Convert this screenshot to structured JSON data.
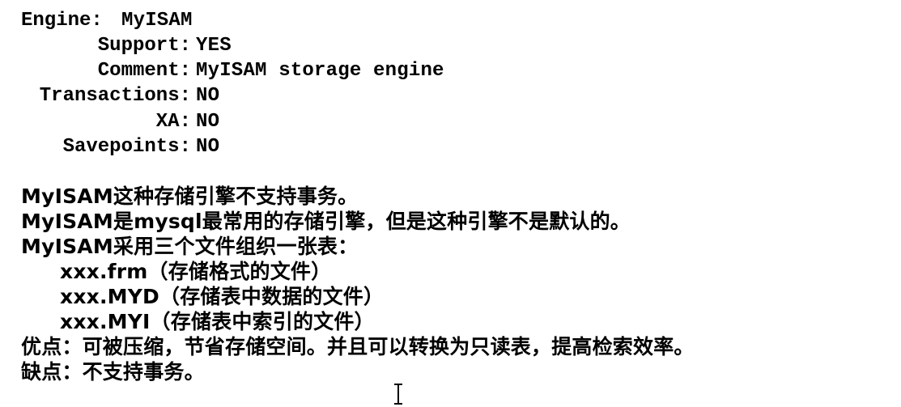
{
  "engine_block": {
    "engine": {
      "key": "Engine:",
      "value": "MyISAM"
    },
    "support": {
      "key": "Support:",
      "value": "YES"
    },
    "comment": {
      "key": "Comment:",
      "value": "MyISAM storage engine"
    },
    "transactions": {
      "key": "Transactions:",
      "value": "NO"
    },
    "xa": {
      "key": "XA:",
      "value": "NO"
    },
    "savepoints": {
      "key": "Savepoints:",
      "value": "NO"
    }
  },
  "notes": {
    "line1": "MyISAM这种存储引擎不支持事务。",
    "line2": "MyISAM是mysql最常用的存储引擎，但是这种引擎不是默认的。",
    "line3": "MyISAM采用三个文件组织一张表：",
    "files": [
      "xxx.frm（存储格式的文件）",
      "xxx.MYD（存储表中数据的文件）",
      "xxx.MYI（存储表中索引的文件）"
    ],
    "pros": "优点：可被压缩，节省存储空间。并且可以转换为只读表，提高检索效率。",
    "cons": "缺点：不支持事务。"
  },
  "cursor_icon": "text-cursor-icon"
}
